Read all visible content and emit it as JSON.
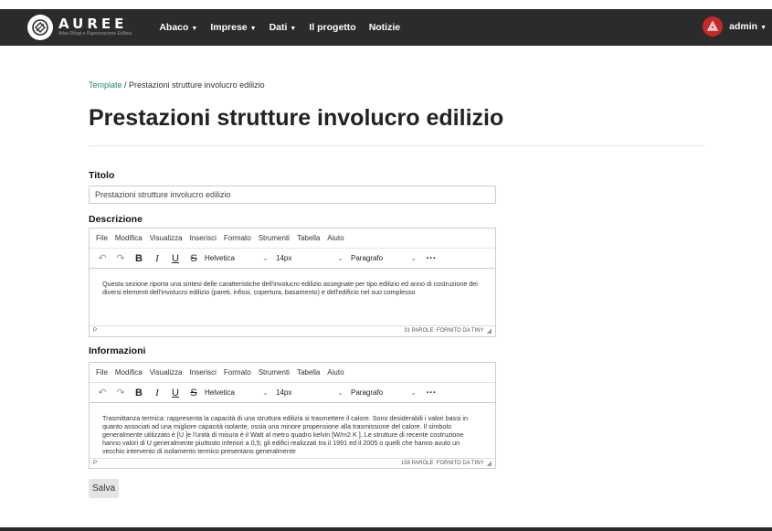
{
  "brand": {
    "name": "AUREE",
    "tagline": "Atlas Rifugi e Rigenerazione Edilizia"
  },
  "nav": [
    {
      "label": "Abaco",
      "dropdown": true
    },
    {
      "label": "Imprese",
      "dropdown": true
    },
    {
      "label": "Dati",
      "dropdown": true
    },
    {
      "label": "Il progetto",
      "dropdown": false
    },
    {
      "label": "Notizie",
      "dropdown": false
    }
  ],
  "user": {
    "name": "admin"
  },
  "breadcrumb": {
    "parent": "Template",
    "separator": " / ",
    "current": "Prestazioni strutture involucro edilizio"
  },
  "page_title": "Prestazioni strutture involucro edilizio",
  "form": {
    "titolo_label": "Titolo",
    "titolo_value": "Prestazioni strutture involucro edilizio",
    "descrizione_label": "Descrizione",
    "informazioni_label": "Informazioni",
    "save_label": "Salva"
  },
  "editor": {
    "menu": [
      "File",
      "Modifica",
      "Visualizza",
      "Inserisci",
      "Formato",
      "Strumenti",
      "Tabella",
      "Aiuto"
    ],
    "font": "Helvetica",
    "size": "14px",
    "block": "Paragrafo",
    "branding": "FORNITO DA TINY",
    "path": "P"
  },
  "descrizione": {
    "text": "Questa sezione riporta una sintesi delle caratteristiche dell'involucro edilizio assegnate per tipo edilizio ed anno di costruzione dei diversi elementi dell'involucro edilizio (pareti, infissi, copertura, basamento) e dell'edificio nel suo complesso",
    "wordcount": "31 PAROLE"
  },
  "informazioni": {
    "text": "Trasmittanza termica: rappresenta la capacità di una struttura edilizia si trasmettere il calore. Sono desiderabili i valori bassi in quanto associati ad una migliore capacità isolante, ossia una minore propensione alla trasmissione del calore. Il simbolo generalmente utilizzato è [U ]e l'unità di misura è il Watt al metro quadro kelvin [W/m2 K ]. Le strutture di recente costruzione hanno valori di U generalmente piuttosto inferiori a 0,5; gli edifici realizzati tra il 1991 ed il 2005 o quelli che hanno avuto un vecchio intervento di isolamento termico presentano generalmente",
    "wordcount": "158 PAROLE"
  },
  "colors": {
    "navbar": "#2b2b2b",
    "link": "#26876b",
    "avatar": "#c62828"
  }
}
